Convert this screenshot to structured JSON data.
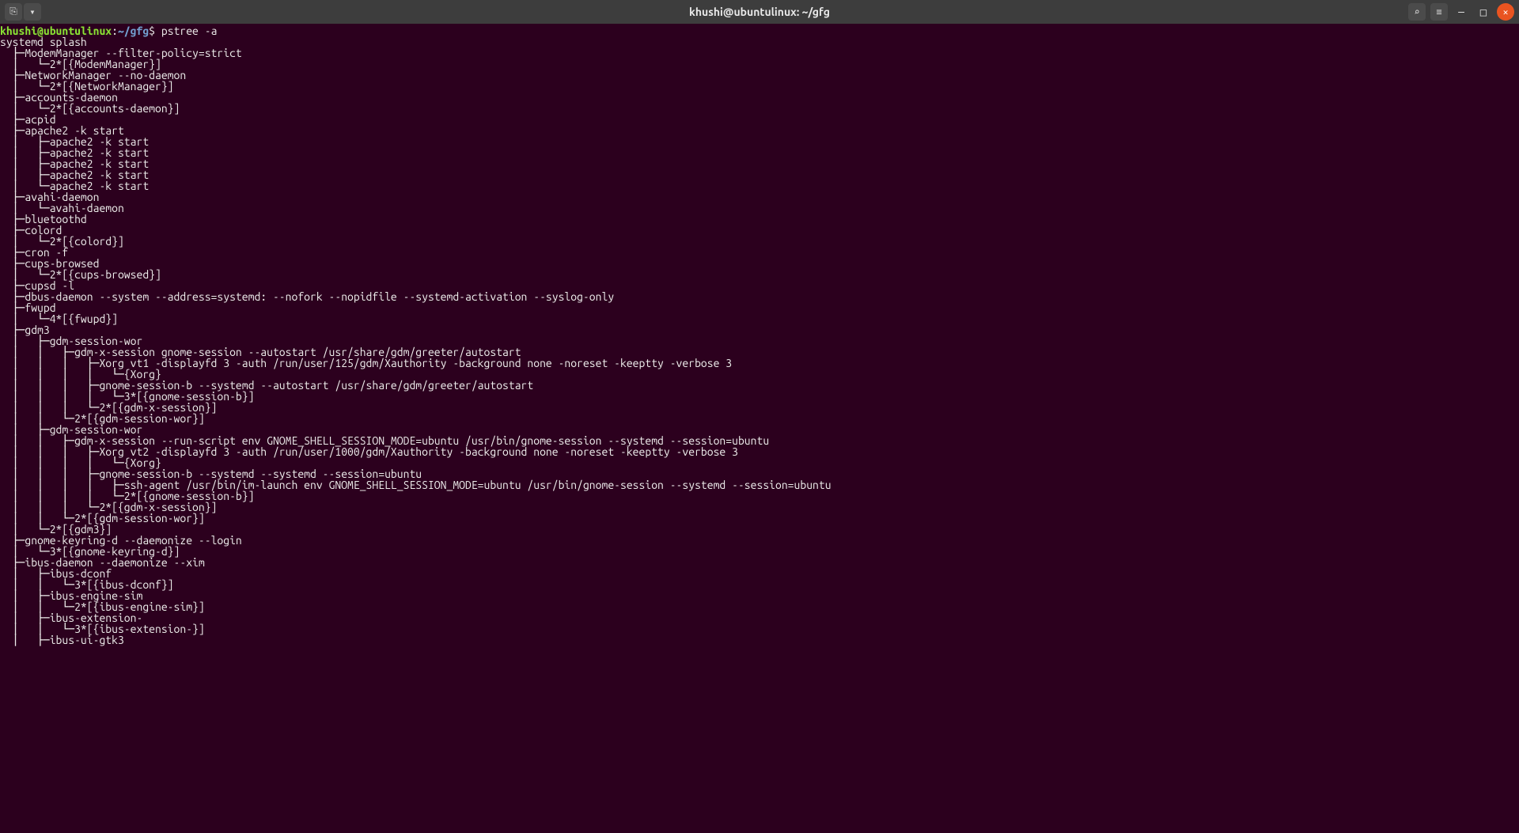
{
  "window": {
    "title": "khushi@ubuntulinux: ~/gfg"
  },
  "prompt": {
    "userhost": "khushi@ubuntulinux",
    "sep": ":",
    "path": "~/gfg",
    "dollar": "$",
    "command": "pstree -a"
  },
  "toolbar": {
    "new_tab_glyph": "⎘",
    "dropdown_glyph": "▾",
    "search_glyph": "⌕",
    "menu_glyph": "≡",
    "minimize_glyph": "—",
    "maximize_glyph": "□",
    "close_glyph": "✕"
  },
  "tree": "systemd splash\n  ├─ModemManager --filter-policy=strict\n  │   └─2*[{ModemManager}]\n  ├─NetworkManager --no-daemon\n  │   └─2*[{NetworkManager}]\n  ├─accounts-daemon\n  │   └─2*[{accounts-daemon}]\n  ├─acpid\n  ├─apache2 -k start\n  │   ├─apache2 -k start\n  │   ├─apache2 -k start\n  │   ├─apache2 -k start\n  │   ├─apache2 -k start\n  │   └─apache2 -k start\n  ├─avahi-daemon\n  │   └─avahi-daemon\n  ├─bluetoothd\n  ├─colord\n  │   └─2*[{colord}]\n  ├─cron -f\n  ├─cups-browsed\n  │   └─2*[{cups-browsed}]\n  ├─cupsd -l\n  ├─dbus-daemon --system --address=systemd: --nofork --nopidfile --systemd-activation --syslog-only\n  ├─fwupd\n  │   └─4*[{fwupd}]\n  ├─gdm3\n  │   ├─gdm-session-wor\n  │   │   ├─gdm-x-session gnome-session --autostart /usr/share/gdm/greeter/autostart\n  │   │   │   ├─Xorg vt1 -displayfd 3 -auth /run/user/125/gdm/Xauthority -background none -noreset -keeptty -verbose 3\n  │   │   │   │   └─{Xorg}\n  │   │   │   ├─gnome-session-b --systemd --autostart /usr/share/gdm/greeter/autostart\n  │   │   │   │   └─3*[{gnome-session-b}]\n  │   │   │   └─2*[{gdm-x-session}]\n  │   │   └─2*[{gdm-session-wor}]\n  │   ├─gdm-session-wor\n  │   │   ├─gdm-x-session --run-script env GNOME_SHELL_SESSION_MODE=ubuntu /usr/bin/gnome-session --systemd --session=ubuntu\n  │   │   │   ├─Xorg vt2 -displayfd 3 -auth /run/user/1000/gdm/Xauthority -background none -noreset -keeptty -verbose 3\n  │   │   │   │   └─{Xorg}\n  │   │   │   ├─gnome-session-b --systemd --systemd --session=ubuntu\n  │   │   │   │   ├─ssh-agent /usr/bin/im-launch env GNOME_SHELL_SESSION_MODE=ubuntu /usr/bin/gnome-session --systemd --session=ubuntu\n  │   │   │   │   └─2*[{gnome-session-b}]\n  │   │   │   └─2*[{gdm-x-session}]\n  │   │   └─2*[{gdm-session-wor}]\n  │   └─2*[{gdm3}]\n  ├─gnome-keyring-d --daemonize --login\n  │   └─3*[{gnome-keyring-d}]\n  ├─ibus-daemon --daemonize --xim\n  │   ├─ibus-dconf\n  │   │   └─3*[{ibus-dconf}]\n  │   ├─ibus-engine-sim\n  │   │   └─2*[{ibus-engine-sim}]\n  │   ├─ibus-extension-\n  │   │   └─3*[{ibus-extension-}]\n  │   ├─ibus-ui-gtk3"
}
